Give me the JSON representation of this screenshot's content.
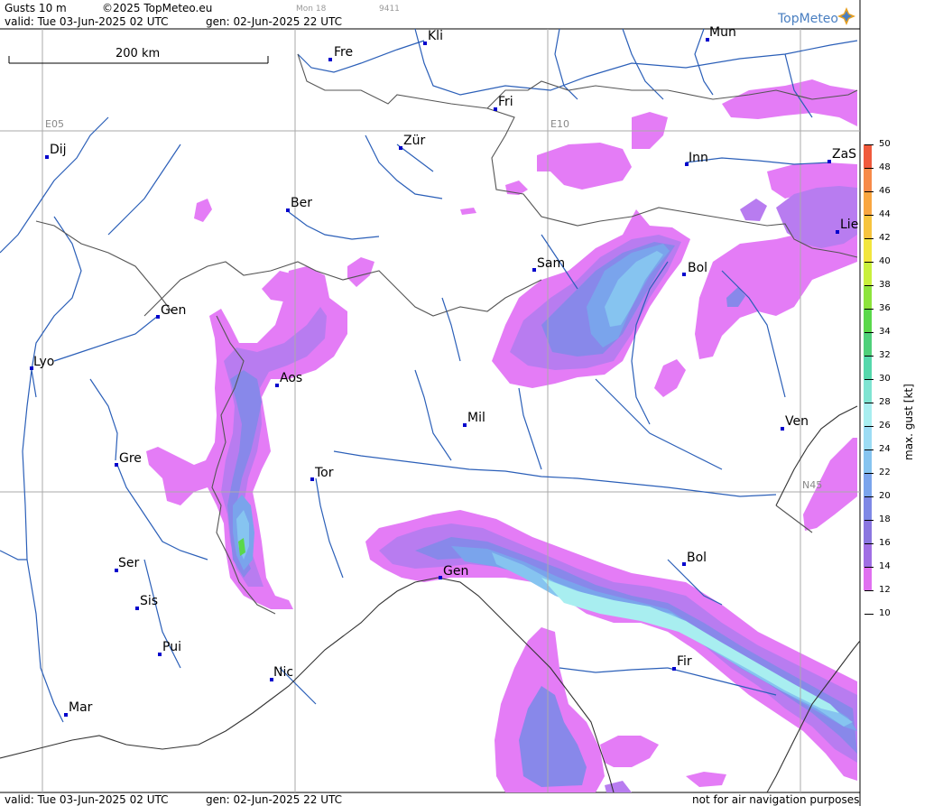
{
  "header": {
    "title": "Gusts 10 m",
    "copyright": "©2025 TopMeteo.eu",
    "valid": "valid:  Tue  03-Jun-2025  02 UTC",
    "gen": "gen:  02-Jun-2025 22 UTC",
    "small1": "Mon 18",
    "small2": "9411",
    "brand": "TopMeteo"
  },
  "footer": {
    "valid": "valid:  Tue  03-Jun-2025  02 UTC",
    "gen": "gen:  02-Jun-2025 22 UTC",
    "disclaimer": "not for air navigation purposes"
  },
  "scale_bar": {
    "label": "200 km"
  },
  "grid_labels": {
    "e05": "E05",
    "e10": "E10",
    "n45": "N45"
  },
  "cities": [
    {
      "name": "Kli"
    },
    {
      "name": "Mun"
    },
    {
      "name": "Fre"
    },
    {
      "name": "Fri"
    },
    {
      "name": "Dij"
    },
    {
      "name": "Zür"
    },
    {
      "name": "Inn"
    },
    {
      "name": "ZaS"
    },
    {
      "name": "Ber"
    },
    {
      "name": "Lie"
    },
    {
      "name": "Sam"
    },
    {
      "name": "Bol"
    },
    {
      "name": "Gen"
    },
    {
      "name": "Lyo"
    },
    {
      "name": "Aos"
    },
    {
      "name": "Mil"
    },
    {
      "name": "Ven"
    },
    {
      "name": "Gre"
    },
    {
      "name": "Tor"
    },
    {
      "name": "Ser"
    },
    {
      "name": "Gen"
    },
    {
      "name": "Bol"
    },
    {
      "name": "Sis"
    },
    {
      "name": "Pui"
    },
    {
      "name": "Nic"
    },
    {
      "name": "Fir"
    },
    {
      "name": "Mar"
    }
  ],
  "legend": {
    "title": "max. gust [kt]",
    "values": [
      "50",
      "48",
      "46",
      "44",
      "42",
      "40",
      "38",
      "36",
      "34",
      "32",
      "30",
      "28",
      "26",
      "24",
      "22",
      "20",
      "18",
      "16",
      "14",
      "12",
      "10"
    ],
    "colors": [
      "#f05a3c",
      "#f78a48",
      "#f9a640",
      "#f7c43d",
      "#f2e63d",
      "#c9f03c",
      "#8de43c",
      "#5ad84a",
      "#4ed07a",
      "#55d8ac",
      "#7fe4d2",
      "#a8eef0",
      "#9cdcf4",
      "#86c4f0",
      "#7aa4ec",
      "#7e88e6",
      "#8a76e0",
      "#a06ee4",
      "#e070f0"
    ]
  },
  "colors": {
    "gust_12_14": "#e47cf6",
    "gust_14_16": "#b87cf0",
    "gust_16_18": "#9a7ceb",
    "gust_18_20": "#8888ea",
    "gust_20_22": "#7aa4ec",
    "gust_22_24": "#86c4f0",
    "gust_24_26": "#a8eef0",
    "gust_30": "#5ad84a",
    "river": "#2b5fb8",
    "border": "#555555",
    "coast": "#333333",
    "grid": "#aaaaaa"
  }
}
